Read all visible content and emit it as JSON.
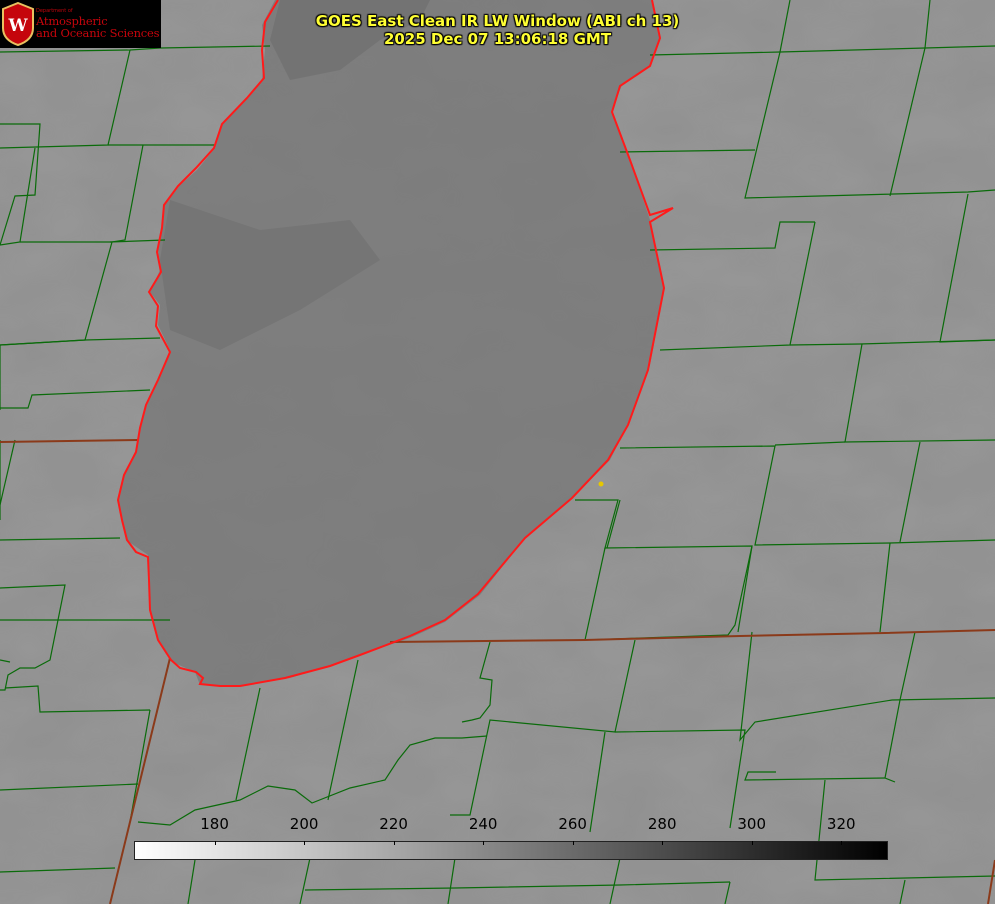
{
  "title": {
    "line1": "GOES East Clean IR LW Window (ABI ch 13)",
    "line2": "2025 Dec 07 13:06:18 GMT"
  },
  "logo": {
    "department": "Department of",
    "line1": "Atmospheric",
    "line2": "and Oceanic Sciences",
    "seal_letter": "W"
  },
  "colorbar": {
    "min": 162,
    "max": 330,
    "ticks": [
      "180",
      "200",
      "220",
      "240",
      "260",
      "280",
      "300",
      "320"
    ],
    "gradient": [
      "#ffffff",
      "#000000"
    ]
  },
  "colors": {
    "background": "#8f8f8f",
    "lake": "#808080",
    "county_lines": "#0a6b0a",
    "state_lines": "#8b3a1a",
    "shoreline": "#ff1a1a",
    "title": "#ffff33",
    "marker": "#e6c700"
  }
}
